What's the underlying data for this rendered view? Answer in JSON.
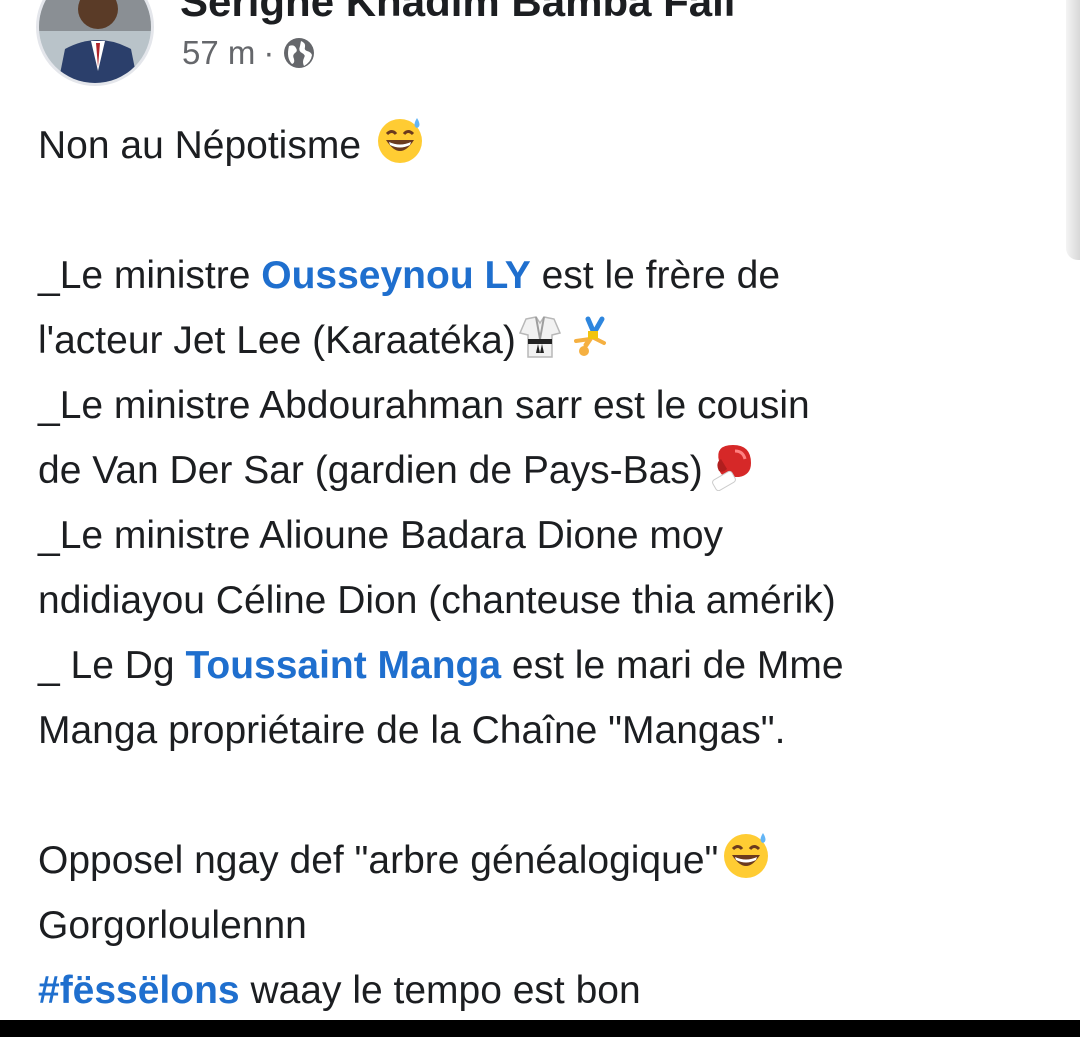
{
  "post": {
    "author": {
      "name": "Serigne Khadim Bamba Fall",
      "avatar_icon": "profile-photo-icon"
    },
    "timestamp": "57 m",
    "separator": "·",
    "visibility_icon": "globe-icon",
    "body": {
      "line1": "Non au Népotisme",
      "l2_pre": "_Le ministre ",
      "l2_mention": "Ousseynou LY",
      "l2_post": " est le frère de",
      "l3": "l'acteur Jet Lee (Karaatéka)",
      "l4": "_Le ministre Abdourahman sarr est le cousin",
      "l5": "de Van Der Sar (gardien de Pays-Bas)",
      "l6": "_Le ministre Alioune Badara Dione moy",
      "l7": "ndidiayou Céline Dion (chanteuse thia amérik)",
      "l8_pre": "_ Le Dg ",
      "l8_mention": "Toussaint Manga",
      "l8_post": " est le mari de Mme",
      "l9": "Manga propriétaire de la Chaîne \"Mangas\".",
      "l10": "Opposel ngay def \"arbre généalogique\"",
      "l11": "Gorgorloulennn",
      "l12_hashtag": "#fëssëlons",
      "l12_post": " waay le tempo est bon"
    },
    "emojis": [
      "grinning-sweat-emoji",
      "martial-arts-uniform-emoji",
      "cartwheel-emoji",
      "boxing-glove-emoji",
      "grinning-sweat-emoji"
    ],
    "colors": {
      "mention": "#1f6fce",
      "text": "#1c1e21",
      "meta": "#65676b"
    }
  }
}
